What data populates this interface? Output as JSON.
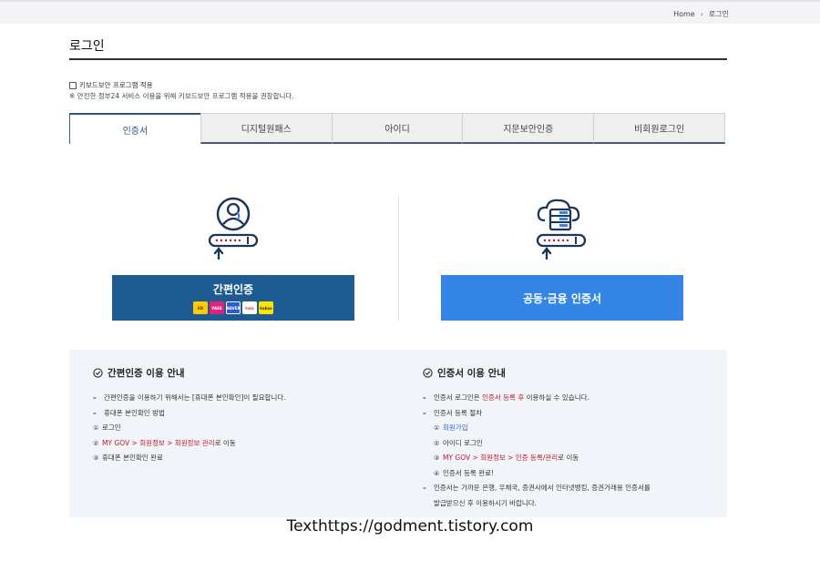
{
  "breadcrumb": {
    "home": "Home",
    "separator": "›",
    "current": "로그인"
  },
  "page": {
    "title": "로그인"
  },
  "keyboard": {
    "label": "키보드보안 프로그램 적용",
    "note": "※ 안전한 정부24 서비스 이용을 위해 키보드보안 프로그램 적용을 권장합니다."
  },
  "tabs": [
    {
      "label": "인증서",
      "active": true
    },
    {
      "label": "디지털원패스",
      "active": false
    },
    {
      "label": "아이디",
      "active": false
    },
    {
      "label": "지문보안인증",
      "active": false
    },
    {
      "label": "비회원로그인",
      "active": false
    }
  ],
  "simple_auth": {
    "label": "간편인증",
    "logos": [
      "KB",
      "PASS",
      "NAVER",
      "toss",
      "kakao"
    ]
  },
  "cert_auth": {
    "label": "공동·금융 인증서"
  },
  "guide_simple": {
    "title": "간편인증 이용 안내",
    "line1": "간편인증을 이용하기 위해서는 [휴대폰 본인확인]이 필요합니다.",
    "line2": "휴대폰 본인확인 방법",
    "step1_num": "①",
    "step1": "로그인",
    "step2_num": "②",
    "step2_red": "MY GOV > 회원정보 > 회원정보 관리",
    "step2_rest": "로 이동",
    "step3_num": "③",
    "step3": "휴대폰 본인확인 완료"
  },
  "guide_cert": {
    "title": "인증서 이용 안내",
    "line1_a": "인증서 로그인은 ",
    "line1_red": "인증서 등록 후",
    "line1_b": " 이용하실 수 있습니다.",
    "line2": "인증서 등록 절차",
    "step1_num": "①",
    "step1": "회원가입",
    "step2_num": "②",
    "step2": "아이디 로그인",
    "step3_num": "③",
    "step3_red": "MY GOV > 회원정보 > 인증 등록/관리",
    "step3_rest": "로 이동",
    "step4_num": "④",
    "step4": "인증서 등록 완료!",
    "line3": "인증서는 가까운 은행, 우체국, 증권사에서 인터넷뱅킹, 증권거래용 인증서를",
    "line3b": "발급받으신 후 이용하시기 바랍니다."
  },
  "footer": {
    "text": "Texthttps://godment.tistory.com"
  },
  "colors": {
    "primary": "#1f5b93",
    "accent": "#3585e6",
    "tab_border": "#3e5f80",
    "highlight": "#c0182e"
  }
}
